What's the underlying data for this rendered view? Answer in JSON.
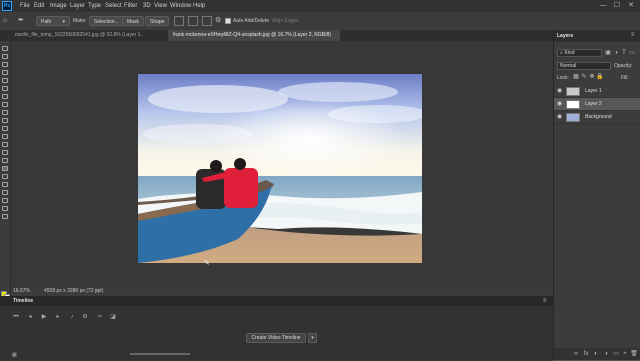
{
  "app": {
    "logo": "Ps"
  },
  "menu": [
    "File",
    "Edit",
    "Image",
    "Layer",
    "Type",
    "Select",
    "Filter",
    "3D",
    "View",
    "Window",
    "Help"
  ],
  "window_controls": {
    "minimize": "—",
    "maximize": "☐",
    "close": "✕"
  },
  "options_bar": {
    "mode_value": "Path",
    "make_label": "Make:",
    "selection_button": "Selection...",
    "mask_button": "Mask",
    "shape_button": "Shape",
    "auto_add_delete_label": "Auto Add/Delete",
    "align_edges_label": "Align Edges"
  },
  "tabs": [
    {
      "label": "medin_file_temp_1622550682541.jpg @ 32.8% (Layer 1, RGB/8)",
      "close": "×"
    },
    {
      "label": "frank-mckenna-eXHeq48Z-Q4-unsplash.jpg @ 16.7% (Layer 2, RGB/8) *",
      "close": "×"
    }
  ],
  "status": {
    "zoom": "16.67%",
    "doc_info": "4928 px x 3280 px (72 ppi)"
  },
  "timeline": {
    "title": "Timeline",
    "create_button": "Create Video Timeline",
    "menu_icon": "≡"
  },
  "layers_panel": {
    "title": "Layers",
    "filter_kind": "Kind",
    "blend_mode": "Normal",
    "opacity_label": "Opacity:",
    "lock_label": "Lock:",
    "fill_label": "Fill:",
    "layers": [
      {
        "name": "Layer 1",
        "visible": true,
        "selected": false
      },
      {
        "name": "Layer 2",
        "visible": true,
        "selected": true
      },
      {
        "name": "Background",
        "visible": true,
        "selected": false
      }
    ],
    "footer_icons": [
      "link-icon",
      "fx-icon",
      "mask-icon",
      "adjustment-icon",
      "folder-icon",
      "new-layer-icon",
      "trash-icon"
    ],
    "footer_glyphs": [
      "∞",
      "fx",
      "◐",
      "◑",
      "▭",
      "+",
      "🗑"
    ]
  },
  "colors": {
    "accent": "#31a8ff",
    "shirt": "#e0203a",
    "boat": "#2f6fa8",
    "sky_top": "#6f7fc9",
    "sand": "#c9a27c"
  }
}
